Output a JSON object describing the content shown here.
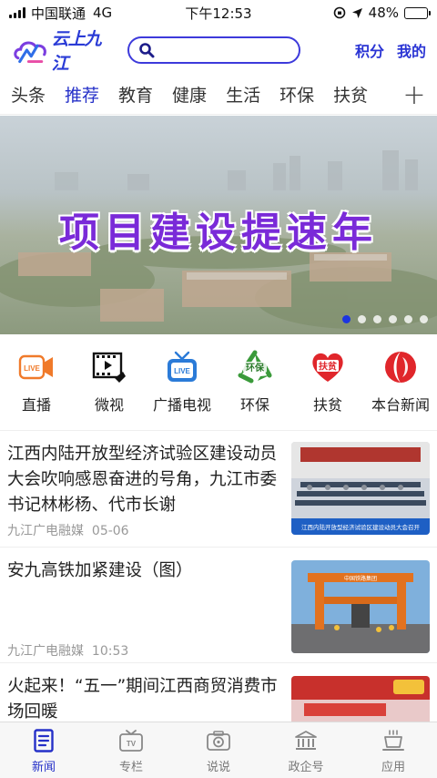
{
  "status": {
    "carrier": "中国联通",
    "network": "4G",
    "time": "下午12:53",
    "battery": "48%",
    "battery_level": 0.48
  },
  "header": {
    "logo_text": "云上九江",
    "search_placeholder": "",
    "links": [
      "积分",
      "我的"
    ]
  },
  "tabs": [
    "头条",
    "推荐",
    "教育",
    "健康",
    "生活",
    "环保",
    "扶贫"
  ],
  "active_tab": "推荐",
  "tab_add": "+",
  "banner": {
    "title": "项目建设提速年",
    "slide_count": 6,
    "active_slide": 0
  },
  "channels": [
    {
      "label": "直播",
      "icon": "live-camera-icon",
      "badge": "LIVE"
    },
    {
      "label": "微视",
      "icon": "video-film-icon",
      "badge": ""
    },
    {
      "label": "广播电视",
      "icon": "tv-icon",
      "badge": "LIVE"
    },
    {
      "label": "环保",
      "icon": "recycle-icon",
      "badge": "环保"
    },
    {
      "label": "扶贫",
      "icon": "poverty-heart-icon",
      "badge": "扶贫"
    },
    {
      "label": "本台新闻",
      "icon": "station-logo-icon",
      "badge": ""
    }
  ],
  "news": [
    {
      "title": "江西内陆开放型经济试验区建设动员大会吹响感恩奋进的号角，九江市委书记林彬杨、代市长谢",
      "source": "九江广电融媒",
      "time": "05-06",
      "thumb_caption": "江西内陆开放型经济试验区建设动员大会召开"
    },
    {
      "title": "安九高铁加紧建设（图）",
      "source": "九江广电融媒",
      "time": "10:53",
      "thumb_caption": "中国铁路集团"
    },
    {
      "title": "火起来！“五一”期间江西商贸消费市场回暖",
      "source": "",
      "time": "",
      "thumb_caption": ""
    }
  ],
  "bottom_nav": [
    {
      "label": "新闻",
      "icon": "news-icon",
      "active": true
    },
    {
      "label": "专栏",
      "icon": "tv-column-icon",
      "active": false
    },
    {
      "label": "说说",
      "icon": "camera-icon",
      "active": false
    },
    {
      "label": "政企号",
      "icon": "government-icon",
      "active": false
    },
    {
      "label": "应用",
      "icon": "apps-cup-icon",
      "active": false
    }
  ],
  "colors": {
    "accent": "#2530c8",
    "banner_title": "#7a2ad8",
    "live_orange": "#f07a2a",
    "red": "#e0262b",
    "green": "#3a9a3a"
  }
}
